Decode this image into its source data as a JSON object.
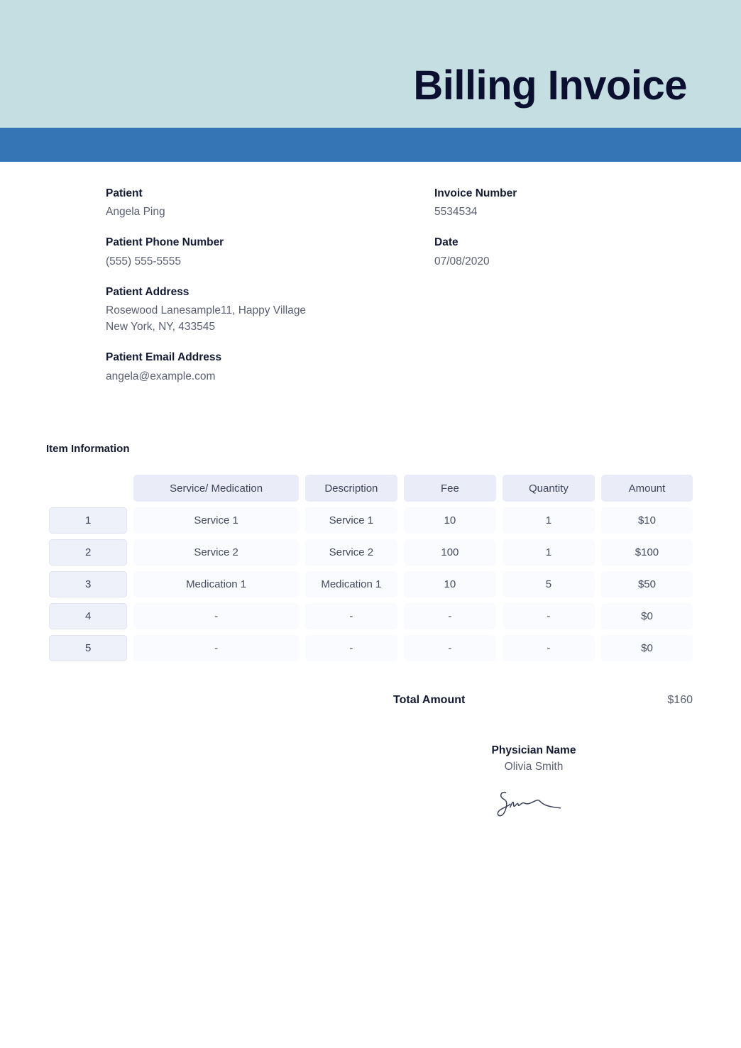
{
  "document": {
    "title": "Billing Invoice",
    "header_bg": "#c5dee1",
    "accent_bg": "#3575b5",
    "title_color": "#0c1030"
  },
  "meta": {
    "left": [
      {
        "label": "Patient",
        "value": "Angela Ping"
      },
      {
        "label": "Patient Phone Number",
        "value": "(555) 555-5555"
      },
      {
        "label": "Patient Address",
        "value": "Rosewood Lanesample11, Happy Village\nNew York, NY, 433545"
      },
      {
        "label": "Patient Email Address",
        "value": "angela@example.com"
      }
    ],
    "right": [
      {
        "label": "Invoice Number",
        "value": "5534534"
      },
      {
        "label": "Date",
        "value": "07/08/2020"
      }
    ]
  },
  "items": {
    "section_label": "Item Information",
    "columns": [
      "Service/ Medication",
      "Description",
      "Fee",
      "Quantity",
      "Amount"
    ],
    "rows": [
      {
        "index": "1",
        "service": "Service 1",
        "description": "Service 1",
        "fee": "10",
        "quantity": "1",
        "amount": "$10"
      },
      {
        "index": "2",
        "service": "Service 2",
        "description": "Service 2",
        "fee": "100",
        "quantity": "1",
        "amount": "$100"
      },
      {
        "index": "3",
        "service": "Medication 1",
        "description": "Medication 1",
        "fee": "10",
        "quantity": "5",
        "amount": "$50"
      },
      {
        "index": "4",
        "service": "-",
        "description": "-",
        "fee": "-",
        "quantity": "-",
        "amount": "$0"
      },
      {
        "index": "5",
        "service": "-",
        "description": "-",
        "fee": "-",
        "quantity": "-",
        "amount": "$0"
      }
    ]
  },
  "total": {
    "label": "Total Amount",
    "value": "$160"
  },
  "physician": {
    "label": "Physician Name",
    "name": "Olivia Smith",
    "signature_icon": "handwritten-signature"
  }
}
